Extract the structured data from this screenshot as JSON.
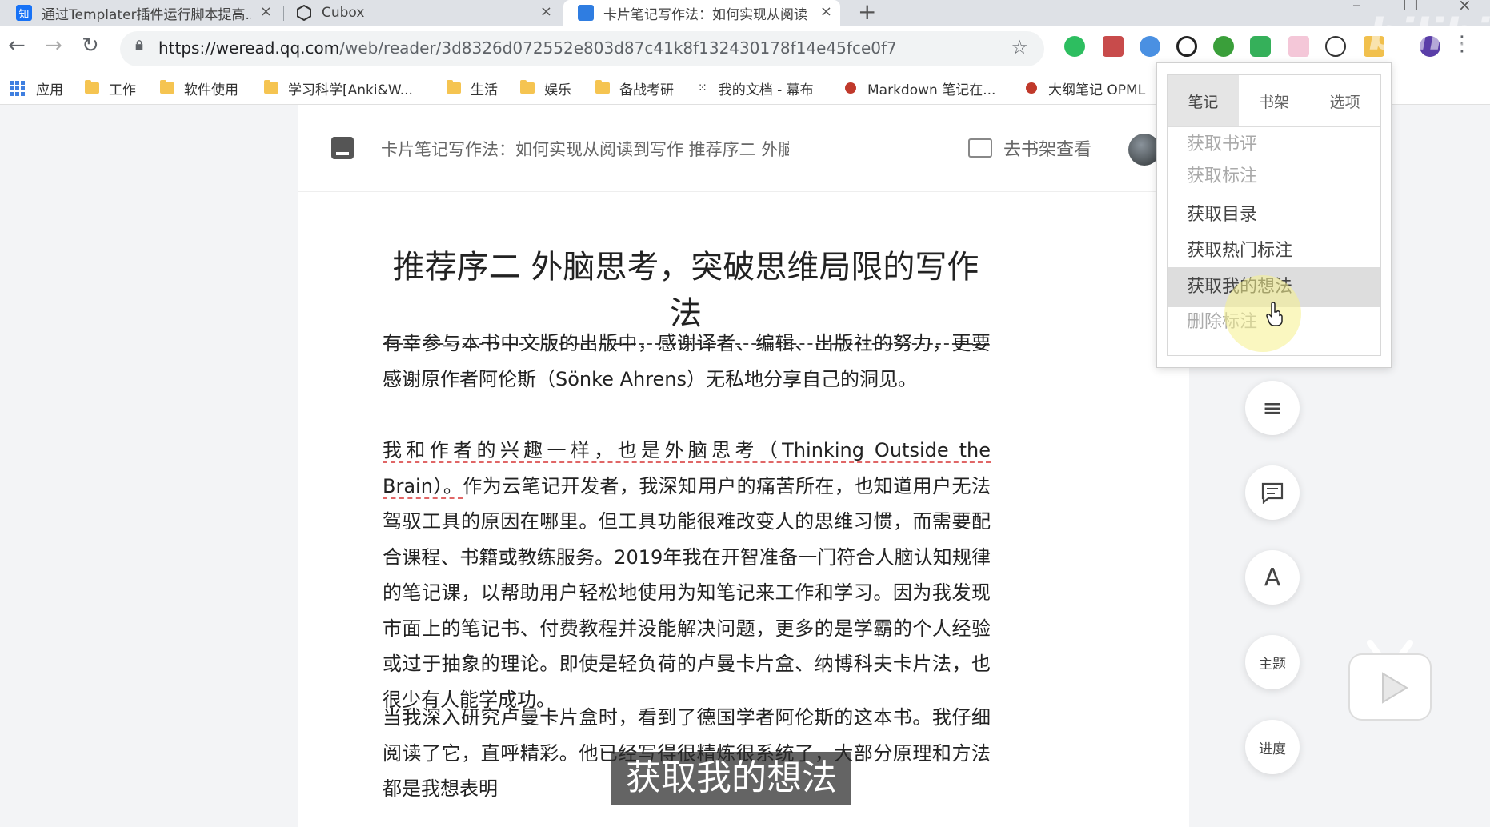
{
  "browser": {
    "tabs": [
      {
        "title": "通过Templater插件运行脚本提高...",
        "favicon": "知",
        "favicon_color": "#1772f6"
      },
      {
        "title": "Cubox",
        "favicon": "cubox-icon"
      },
      {
        "title": "卡片笔记写作法：如何实现从阅读...",
        "favicon": "weread-icon",
        "active": true
      }
    ],
    "url_domain": "https://weread.qq.com",
    "url_path": "/web/reader/3d8326d072552e803d87c41k8f132430178f14e45fce0f7",
    "bookmarks": [
      {
        "label": "应用",
        "icon": "apps-icon"
      },
      {
        "label": "工作",
        "icon": "folder-icon"
      },
      {
        "label": "软件使用",
        "icon": "folder-icon"
      },
      {
        "label": "学习科学[Anki&W...",
        "icon": "folder-icon"
      },
      {
        "label": "生活",
        "icon": "folder-icon"
      },
      {
        "label": "娱乐",
        "icon": "folder-icon"
      },
      {
        "label": "备战考研",
        "icon": "folder-icon"
      },
      {
        "label": "我的文档 - 幕布",
        "icon": "mubu-icon"
      },
      {
        "label": "Markdown 笔记在...",
        "icon": "app-icon"
      },
      {
        "label": "大纲笔记 OPML",
        "icon": "app-icon"
      }
    ]
  },
  "reader": {
    "book_title": "卡片笔记写作法：如何实现从阅读到写作 推荐序二 外脑思考...",
    "shelf_button": "去书架查看",
    "chapter_title": "推荐序二 外脑思考，突破思维局限的写作法",
    "paragraphs": {
      "p1": "有幸参与本书中文版的出版中，感谢译者、编辑、出版社的努力，更要感谢原作者阿伦斯（Sönke Ahrens）无私地分享自己的洞见。",
      "p2_underlined": "我和作者的兴趣一样，也是外脑思考（Thinking Outside the Brain）。",
      "p2_rest": "作为云笔记开发者，我深知用户的痛苦所在，也知道用户无法驾驭工具的原因在哪里。但工具功能很难改变人的思维习惯，而需要配合课程、书籍或教练服务。2019年我在开智准备一门符合人脑认知规律的笔记课，以帮助用户轻松地使用为知笔记来工作和学习。因为我发现市面上的笔记书、付费教程并没能解决问题，更多的是学霸的个人经验或过于抽象的理论。即使是轻负荷的卢曼卡片盒、纳博科夫卡片法，也很少有人能学成功。",
      "p3": "当我深入研究卢曼卡片盒时，看到了德国学者阿伦斯的这本书。我仔细阅读了它，直呼精彩。他已经写得很精炼很系统了，大部分原理和方法都是我想表明"
    },
    "side_buttons": {
      "toc": "≡",
      "notes": "notes",
      "font": "A",
      "theme": "主题",
      "progress": "进度"
    }
  },
  "popup": {
    "tabs": [
      "笔记",
      "书架",
      "选项"
    ],
    "items": [
      {
        "label": "获取书评",
        "state": "faded"
      },
      {
        "label": "获取标注",
        "state": "faded"
      },
      {
        "label": "获取目录",
        "state": "normal"
      },
      {
        "label": "获取热门标注",
        "state": "normal"
      },
      {
        "label": "获取我的想法",
        "state": "hover"
      },
      {
        "label": "删除标注",
        "state": "faded"
      }
    ]
  },
  "subtitle": "获取我的想法",
  "colors": {
    "tabstrip": "#dee1e6",
    "page_bg": "#f3f4f6",
    "underline": "#e06666",
    "cursor_glow": "#f5f08c"
  }
}
